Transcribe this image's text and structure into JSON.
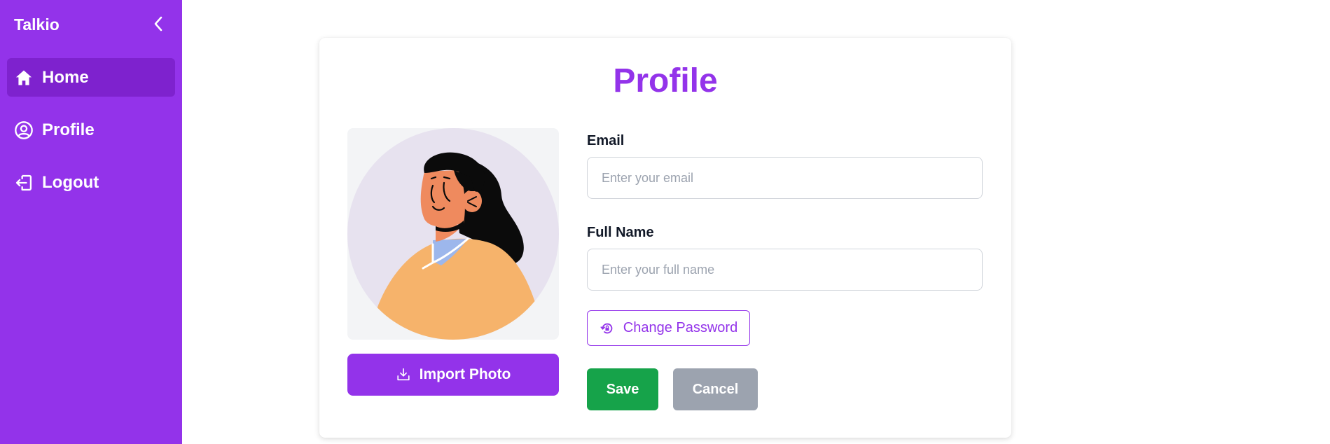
{
  "app": {
    "brand": "Talkio"
  },
  "sidebar": {
    "collapse_icon": "chevron-left-icon",
    "items": [
      {
        "label": "Home",
        "icon": "home-icon",
        "active": true
      },
      {
        "label": "Profile",
        "icon": "user-circle-icon",
        "active": false
      },
      {
        "label": "Logout",
        "icon": "logout-icon",
        "active": false
      }
    ]
  },
  "profile": {
    "title": "Profile",
    "avatar": "woman-avatar-illustration",
    "import_label": "Import Photo",
    "import_icon": "download-icon",
    "email": {
      "label": "Email",
      "placeholder": "Enter your email",
      "value": ""
    },
    "full_name": {
      "label": "Full Name",
      "placeholder": "Enter your full name",
      "value": ""
    },
    "change_password": {
      "label": "Change Password",
      "icon": "lock-reset-icon"
    },
    "save_label": "Save",
    "cancel_label": "Cancel"
  },
  "colors": {
    "primary": "#9333ea",
    "primary_dark": "#7e22ce",
    "save": "#16a34a",
    "cancel": "#9ca3af"
  }
}
